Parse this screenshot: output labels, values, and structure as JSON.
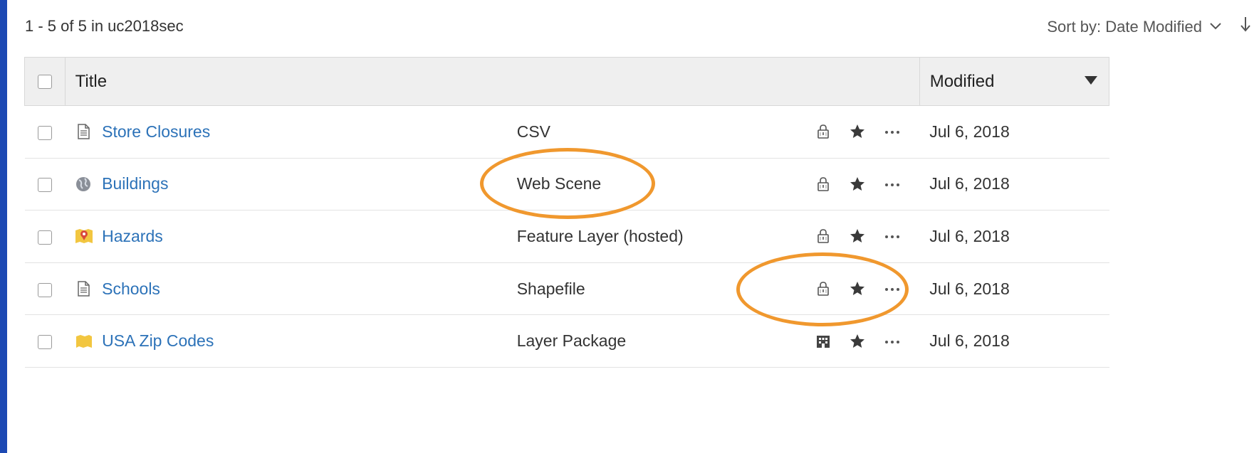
{
  "summary": "1 - 5 of 5 in uc2018sec",
  "sort": {
    "label": "Sort by: Date Modified",
    "chevron": "chevron-down-icon",
    "direction": "arrow-down-icon"
  },
  "table": {
    "headers": {
      "title": "Title",
      "modified": "Modified"
    },
    "rows": [
      {
        "title": "Store Closures",
        "type": "CSV",
        "icon": "document-icon",
        "access": "lock-icon",
        "modified": "Jul 6, 2018"
      },
      {
        "title": "Buildings",
        "type": "Web Scene",
        "icon": "globe-icon",
        "access": "lock-icon",
        "modified": "Jul 6, 2018"
      },
      {
        "title": "Hazards",
        "type": "Feature Layer (hosted)",
        "icon": "map-marker-icon",
        "access": "lock-icon",
        "modified": "Jul 6, 2018"
      },
      {
        "title": "Schools",
        "type": "Shapefile",
        "icon": "document-icon",
        "access": "lock-icon",
        "modified": "Jul 6, 2018"
      },
      {
        "title": "USA Zip Codes",
        "type": "Layer Package",
        "icon": "layer-icon",
        "access": "organization-icon",
        "modified": "Jul 6, 2018"
      }
    ]
  },
  "colors": {
    "link": "#2c72b8",
    "annotation": "#f0982e",
    "frame": "#0f3fa8"
  }
}
